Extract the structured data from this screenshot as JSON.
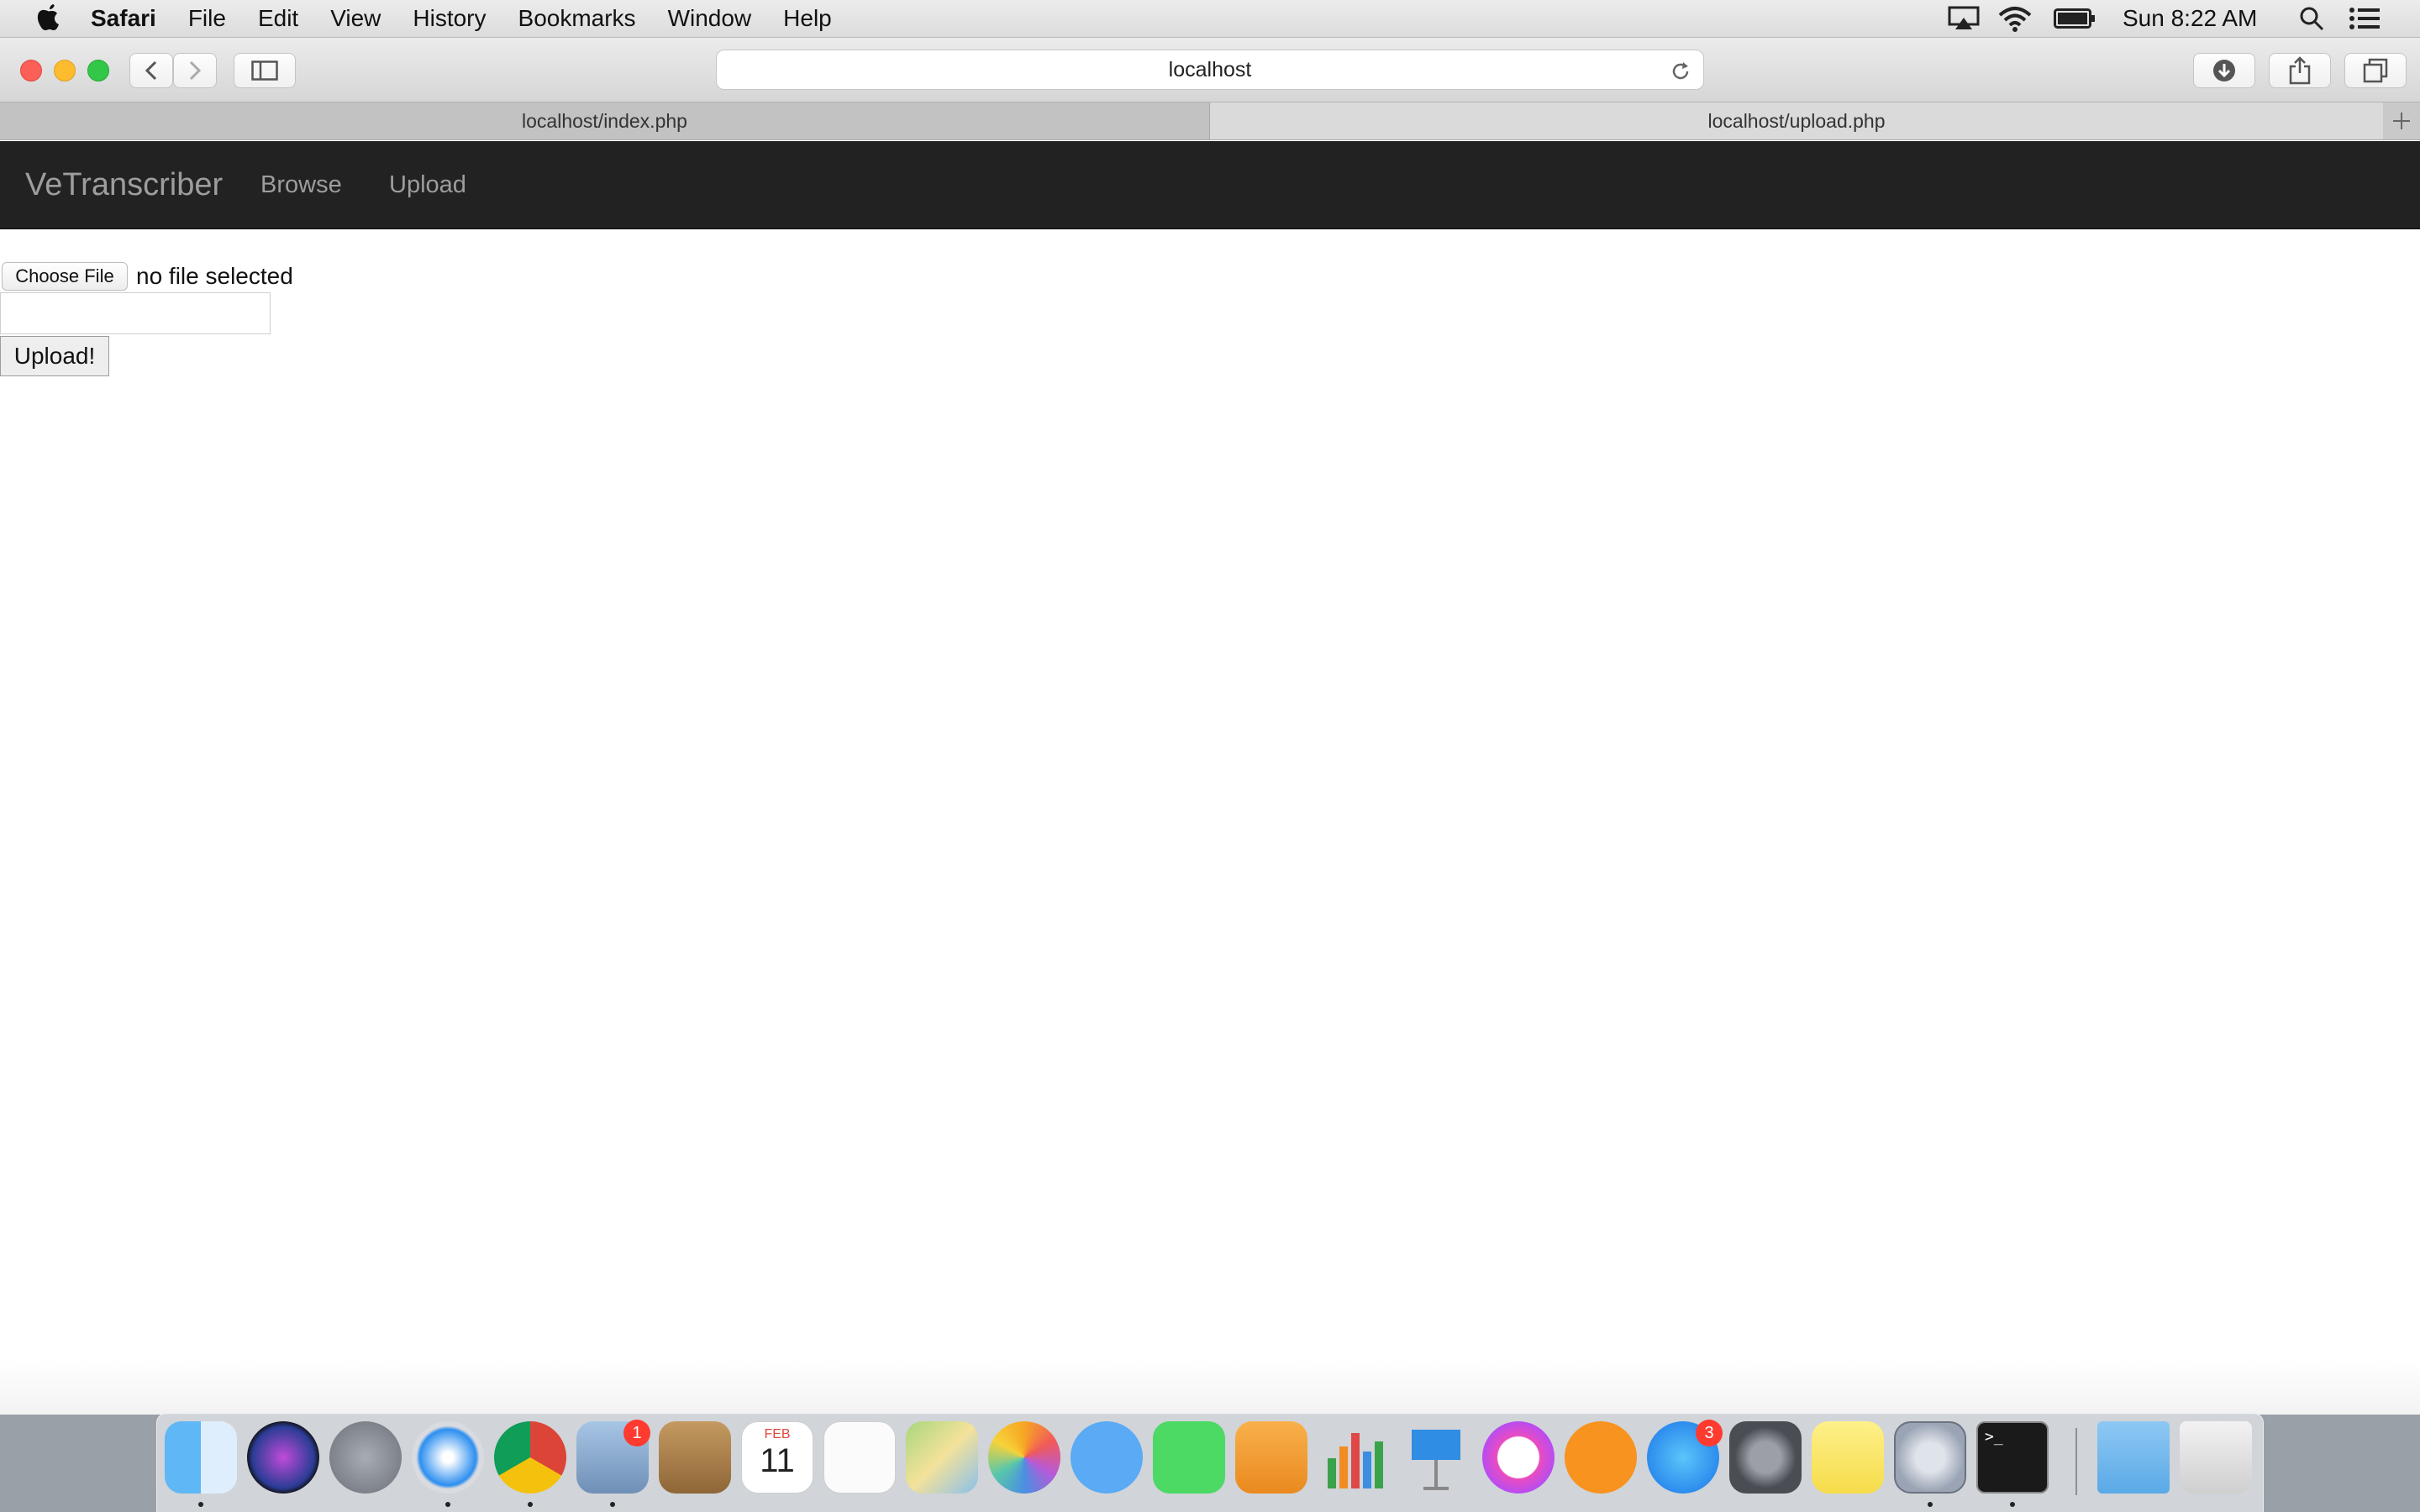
{
  "menubar": {
    "app": "Safari",
    "items": [
      "File",
      "Edit",
      "View",
      "History",
      "Bookmarks",
      "Window",
      "Help"
    ],
    "clock": "Sun 8:22 AM",
    "status_icons": [
      "airplay-icon",
      "wifi-icon",
      "battery-icon",
      "spotlight-search-icon",
      "notification-center-icon"
    ]
  },
  "browser": {
    "url": "localhost",
    "tabs": [
      {
        "label": "localhost/index.php"
      },
      {
        "label": "localhost/upload.php"
      }
    ]
  },
  "page": {
    "brand": "VeTranscriber",
    "nav": [
      "Browse",
      "Upload"
    ],
    "choose_file": "Choose File",
    "file_status": "no file selected",
    "upload_button": "Upload!"
  },
  "dock": {
    "items": [
      "Finder",
      "Siri",
      "Launchpad",
      "Safari",
      "Chrome",
      "Mail",
      "Contacts",
      "Calendar",
      "Reminders",
      "Maps",
      "Photos",
      "Messages",
      "FaceTime",
      "Pages",
      "Numbers",
      "Keynote",
      "iTunes",
      "iBooks",
      "App Store",
      "System Preferences",
      "Notes",
      "Network Utility",
      "Terminal",
      "Downloads",
      "Trash"
    ],
    "calendar_month": "FEB",
    "calendar_day": "11",
    "mail_badge": "1",
    "appstore_badge": "3"
  }
}
